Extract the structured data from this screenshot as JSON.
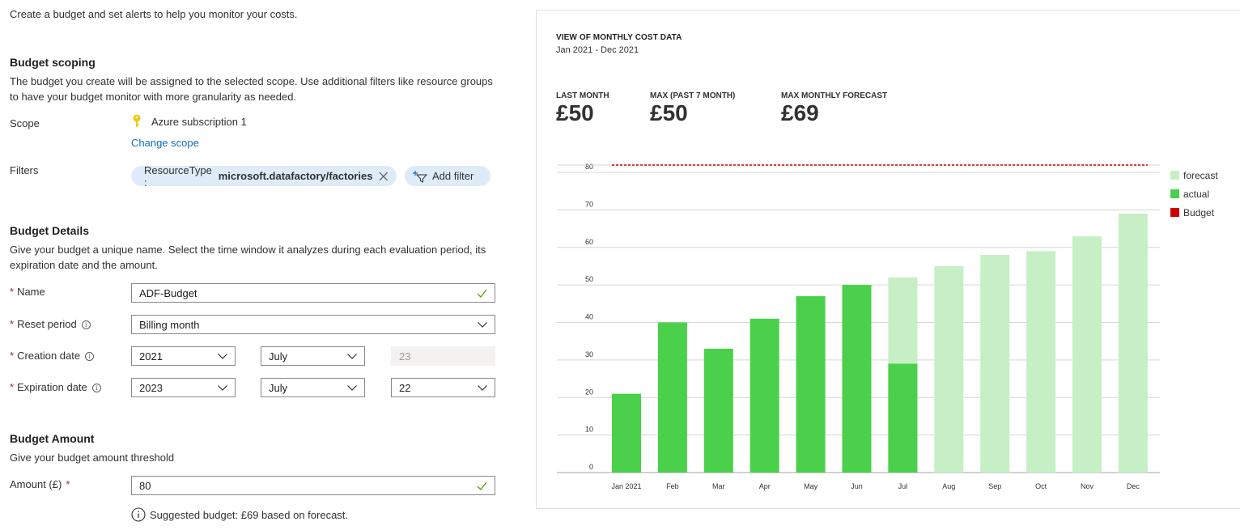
{
  "intro": "Create a budget and set alerts to help you monitor your costs.",
  "scoping": {
    "title": "Budget scoping",
    "desc1": "The budget you create will be assigned to the selected scope. Use additional filters like resource groups",
    "desc2": "to have your budget monitor with more granularity as needed.",
    "scope_label": "Scope",
    "scope_value": "Azure subscription 1",
    "change_scope": "Change scope",
    "filters_label": "Filters",
    "filter_prefix": "ResourceType :",
    "filter_value": "microsoft.datafactory/factories",
    "add_filter": "Add filter"
  },
  "details": {
    "title": "Budget Details",
    "desc1": "Give your budget a unique name. Select the time window it analyzes during each evaluation period, its",
    "desc2": "expiration date and the amount.",
    "name_label": "Name",
    "name_value": "ADF-Budget",
    "reset_label": "Reset period",
    "reset_value": "Billing month",
    "creation_label": "Creation date",
    "creation_year": "2021",
    "creation_month": "July",
    "creation_day": "23",
    "expiration_label": "Expiration date",
    "expiration_year": "2023",
    "expiration_month": "July",
    "expiration_day": "22"
  },
  "amount": {
    "title": "Budget Amount",
    "desc": "Give your budget amount threshold",
    "label": "Amount (£)",
    "value": "80",
    "suggestion": "Suggested budget: £69 based on forecast."
  },
  "panel": {
    "title": "VIEW OF MONTHLY COST DATA",
    "subtitle": "Jan 2021 - Dec 2021",
    "kpis": [
      {
        "label": "LAST MONTH",
        "value": "£50"
      },
      {
        "label": "MAX (PAST 7 MONTH)",
        "value": "£50"
      },
      {
        "label": "MAX MONTHLY FORECAST",
        "value": "£69"
      }
    ]
  },
  "chart_data": {
    "type": "bar",
    "categories": [
      "Jan 2021",
      "Feb",
      "Mar",
      "Apr",
      "May",
      "Jun",
      "Jul",
      "Aug",
      "Sep",
      "Oct",
      "Nov",
      "Dec"
    ],
    "series": [
      {
        "name": "forecast",
        "color": "#c6efc6",
        "values": [
          null,
          null,
          null,
          null,
          null,
          null,
          52,
          55,
          58,
          59,
          63,
          69
        ]
      },
      {
        "name": "actual",
        "color": "#4ad04a",
        "values": [
          21,
          40,
          33,
          41,
          47,
          50,
          29,
          null,
          null,
          null,
          null,
          null
        ]
      },
      {
        "name": "Budget",
        "color": "#d00000",
        "values": [
          80,
          80,
          80,
          80,
          80,
          80,
          80,
          80,
          80,
          80,
          80,
          80
        ]
      }
    ],
    "yticks": [
      0,
      10,
      20,
      30,
      40,
      50,
      60,
      70,
      80
    ],
    "ylim": [
      0,
      80
    ],
    "grid": true,
    "legend": "right"
  },
  "colors": {
    "accent": "#0f6cbd",
    "pill_bg": "#deecf9",
    "valid_check": "#57a300",
    "required": "#a4262c",
    "scope_key": "#f2c811"
  },
  "icons": {
    "scope": "key-icon",
    "remove_filter": "close-icon",
    "add_filter": "add-filter-icon",
    "dropdown": "chevron-down-icon",
    "valid": "checkmark-icon",
    "info": "info-icon"
  }
}
